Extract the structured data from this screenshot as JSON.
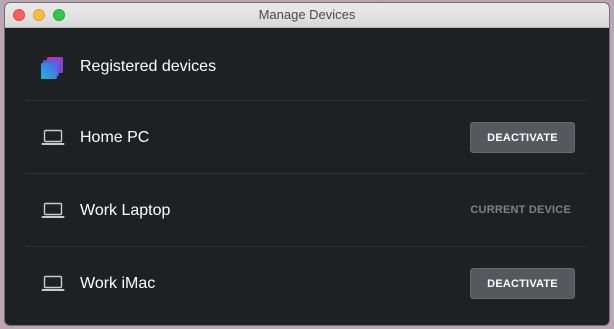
{
  "window": {
    "title": "Manage Devices"
  },
  "header": {
    "label": "Registered devices",
    "icon": "app-logo-icon"
  },
  "devices": [
    {
      "name": "Home PC",
      "icon": "laptop-icon",
      "action_label": "DEACTIVATE"
    },
    {
      "name": "Work Laptop",
      "icon": "laptop-icon",
      "status_label": "CURRENT DEVICE"
    },
    {
      "name": "Work iMac",
      "icon": "laptop-icon",
      "action_label": "DEACTIVATE"
    }
  ],
  "colors": {
    "background": "#1e2022",
    "button": "#55585c",
    "current_device_text": "#7d8286"
  }
}
